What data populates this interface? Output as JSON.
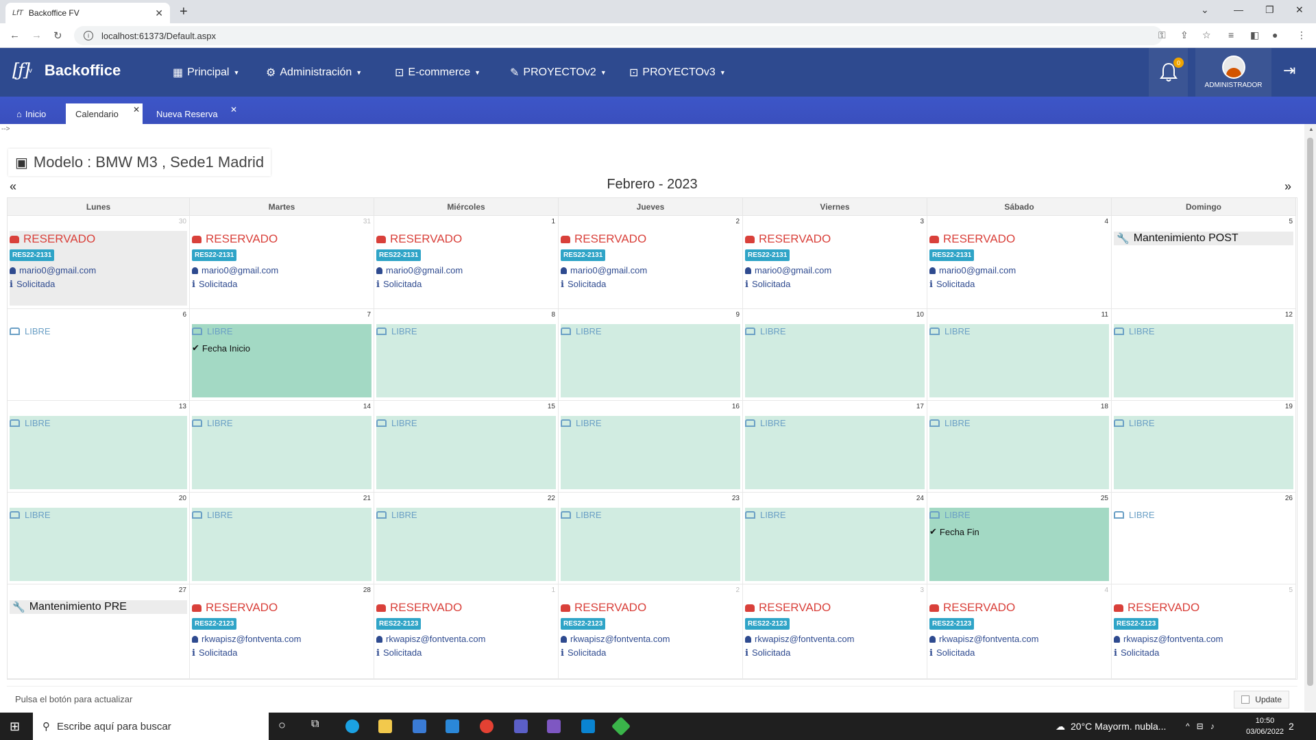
{
  "browser": {
    "tab_title": "Backoffice FV",
    "tab_favicon": "LfT",
    "url": "localhost:61373/Default.aspx"
  },
  "app": {
    "logo_mark": "[ƒ]",
    "logo_sup": "v",
    "brand": "Backoffice",
    "menu": [
      {
        "icon": "building-icon",
        "label": "Principal"
      },
      {
        "icon": "cogs-icon",
        "label": "Administración"
      },
      {
        "icon": "briefcase-icon",
        "label": "E-commerce"
      },
      {
        "icon": "edit-icon",
        "label": "PROYECTOv2"
      },
      {
        "icon": "briefcase-icon",
        "label": "PROYECTOv3"
      }
    ],
    "notifications_count": "0",
    "user_role": "ADMINISTRADOR"
  },
  "tabs": [
    {
      "label": "Inicio",
      "icon": "home-icon",
      "active": false
    },
    {
      "label": "Calendario",
      "active": true,
      "close": "✕"
    },
    {
      "label": "Nueva Reserva",
      "active": false,
      "close": "✕"
    }
  ],
  "comment_text": "-->",
  "model_title": "Modelo : BMW M3 , Sede1 Madrid",
  "calendar": {
    "month_label": "Febrero - 2023",
    "prev": "«",
    "next": "»",
    "weekdays": [
      "Lunes",
      "Martes",
      "Miércoles",
      "Jueves",
      "Viernes",
      "Sábado",
      "Domingo"
    ],
    "weeks": [
      [
        {
          "day": "30",
          "faded": true,
          "type": "res",
          "gray": true,
          "status": "RESERVADO",
          "code": "RES22-2131",
          "email": "mario0@gmail.com",
          "state": "Solicitada"
        },
        {
          "day": "31",
          "faded": true,
          "type": "res",
          "status": "RESERVADO",
          "code": "RES22-2131",
          "email": "mario0@gmail.com",
          "state": "Solicitada"
        },
        {
          "day": "1",
          "type": "res",
          "status": "RESERVADO",
          "code": "RES22-2131",
          "email": "mario0@gmail.com",
          "state": "Solicitada"
        },
        {
          "day": "2",
          "type": "res",
          "status": "RESERVADO",
          "code": "RES22-2131",
          "email": "mario0@gmail.com",
          "state": "Solicitada"
        },
        {
          "day": "3",
          "type": "res",
          "status": "RESERVADO",
          "code": "RES22-2131",
          "email": "mario0@gmail.com",
          "state": "Solicitada"
        },
        {
          "day": "4",
          "type": "res",
          "status": "RESERVADO",
          "code": "RES22-2131",
          "email": "mario0@gmail.com",
          "state": "Solicitada"
        },
        {
          "day": "5",
          "type": "mant",
          "status": "Mantenimiento POST"
        }
      ],
      [
        {
          "day": "6",
          "type": "libre",
          "bg": "none",
          "status": "LIBRE"
        },
        {
          "day": "7",
          "type": "libre",
          "bg": "strong",
          "status": "LIBRE",
          "note": "Fecha Inicio"
        },
        {
          "day": "8",
          "type": "libre",
          "status": "LIBRE"
        },
        {
          "day": "9",
          "type": "libre",
          "status": "LIBRE"
        },
        {
          "day": "10",
          "type": "libre",
          "status": "LIBRE"
        },
        {
          "day": "11",
          "type": "libre",
          "status": "LIBRE"
        },
        {
          "day": "12",
          "type": "libre",
          "status": "LIBRE"
        }
      ],
      [
        {
          "day": "13",
          "type": "libre",
          "status": "LIBRE"
        },
        {
          "day": "14",
          "type": "libre",
          "status": "LIBRE"
        },
        {
          "day": "15",
          "type": "libre",
          "status": "LIBRE"
        },
        {
          "day": "16",
          "type": "libre",
          "status": "LIBRE"
        },
        {
          "day": "17",
          "type": "libre",
          "status": "LIBRE"
        },
        {
          "day": "18",
          "type": "libre",
          "status": "LIBRE"
        },
        {
          "day": "19",
          "type": "libre",
          "status": "LIBRE"
        }
      ],
      [
        {
          "day": "20",
          "type": "libre",
          "status": "LIBRE"
        },
        {
          "day": "21",
          "type": "libre",
          "status": "LIBRE"
        },
        {
          "day": "22",
          "type": "libre",
          "status": "LIBRE"
        },
        {
          "day": "23",
          "type": "libre",
          "status": "LIBRE"
        },
        {
          "day": "24",
          "type": "libre",
          "status": "LIBRE"
        },
        {
          "day": "25",
          "type": "libre",
          "bg": "strong",
          "status": "LIBRE",
          "note": "Fecha Fin"
        },
        {
          "day": "26",
          "type": "libre",
          "bg": "none",
          "status": "LIBRE"
        }
      ],
      [
        {
          "day": "27",
          "type": "mant",
          "status": "Mantenimiento PRE"
        },
        {
          "day": "28",
          "type": "res",
          "status": "RESERVADO",
          "code": "RES22-2123",
          "email": "rkwapisz@fontventa.com",
          "state": "Solicitada"
        },
        {
          "day": "1",
          "faded": true,
          "type": "res",
          "status": "RESERVADO",
          "code": "RES22-2123",
          "email": "rkwapisz@fontventa.com",
          "state": "Solicitada"
        },
        {
          "day": "2",
          "faded": true,
          "type": "res",
          "status": "RESERVADO",
          "code": "RES22-2123",
          "email": "rkwapisz@fontventa.com",
          "state": "Solicitada"
        },
        {
          "day": "3",
          "faded": true,
          "type": "res",
          "status": "RESERVADO",
          "code": "RES22-2123",
          "email": "rkwapisz@fontventa.com",
          "state": "Solicitada"
        },
        {
          "day": "4",
          "faded": true,
          "type": "res",
          "status": "RESERVADO",
          "code": "RES22-2123",
          "email": "rkwapisz@fontventa.com",
          "state": "Solicitada"
        },
        {
          "day": "5",
          "faded": true,
          "type": "res",
          "status": "RESERVADO",
          "code": "RES22-2123",
          "email": "rkwapisz@fontventa.com",
          "state": "Solicitada"
        }
      ]
    ]
  },
  "footer": {
    "text": "Pulsa el botón para actualizar",
    "update_label": "Update"
  },
  "taskbar": {
    "search_placeholder": "Escribe aquí para buscar",
    "weather": "20°C  Mayorm. nubla...",
    "time": "10:50",
    "date": "03/06/2022",
    "notif": "2"
  },
  "colors": {
    "navbar": "#2e4a8f",
    "tabbar": "#3f51b5",
    "reserved": "#d9403a",
    "code_badge": "#2fa4c7",
    "libre_bg": "#d1ece1",
    "libre_strong": "#a3d9c4"
  }
}
